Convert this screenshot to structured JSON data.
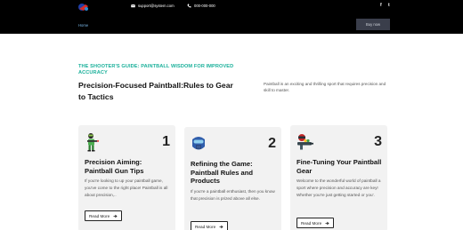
{
  "header": {
    "email": "support@system.com",
    "phone": "000-000-000",
    "social": [
      {
        "icon": "facebook-icon",
        "label": "f"
      },
      {
        "icon": "twitter-icon",
        "label": "t"
      }
    ],
    "nav_home": "Home",
    "cta_label": "Buy now"
  },
  "intro": {
    "eyebrow": "THE SHOOTER'S GUIDE: PAINTBALL WISDOM FOR IMPROVED ACCURACY",
    "heading": "Precision-Focused Paintball:Rules to Gear to Tactics",
    "text": "Paintball is an exciting and thrilling sport that requires precision and skill to master."
  },
  "cards": [
    {
      "number": "1",
      "icon": "paintball-player-icon",
      "title": "Precision Aiming: Paintball Gun Tips",
      "text": "If you're looking to up your paintball game, you've come to the right place! Paintball is all about precision,..",
      "button": "Read More"
    },
    {
      "number": "2",
      "icon": "paintball-mask-icon",
      "title": "Refining the Game: Paintball Rules and Products",
      "text": "If you're a paintball enthusiast, then you know that precision is prized above all else.",
      "button": "Read More"
    },
    {
      "number": "3",
      "icon": "paintball-gun-icon",
      "title": "Fine-Tuning Your Paintball Gear",
      "text": "Welcome to the wonderful world of paintball a sport where precision and accuracy are key! Whether you're just getting started or you'.",
      "button": "Read More"
    }
  ],
  "colors": {
    "header_bg": "#000000",
    "accent": "#1ab09a",
    "card_bg": "#f2f2f2"
  }
}
